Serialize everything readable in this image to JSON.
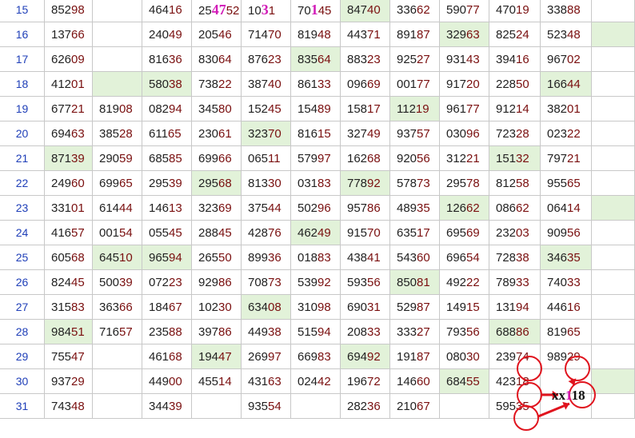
{
  "table": {
    "rows": [
      {
        "day": "15",
        "highlight": [
          7
        ],
        "cells": [
          [
            "852",
            "98"
          ],
          [
            "",
            ""
          ],
          [
            "464",
            "16"
          ],
          [
            "25",
            "52",
            "47"
          ],
          [
            "10",
            "1",
            "3"
          ],
          [
            "70",
            "45",
            "1"
          ],
          [
            "847",
            "40"
          ],
          [
            "336",
            "62"
          ],
          [
            "590",
            "77"
          ],
          [
            "470",
            "19"
          ],
          [
            "338",
            "88"
          ],
          [
            "",
            ""
          ]
        ]
      },
      {
        "day": "16",
        "highlight": [
          9,
          12
        ],
        "cells": [
          [
            "137",
            "66"
          ],
          [
            "",
            ""
          ],
          [
            "240",
            "49"
          ],
          [
            "205",
            "46"
          ],
          [
            "714",
            "70"
          ],
          [
            "819",
            "48"
          ],
          [
            "443",
            "71"
          ],
          [
            "891",
            "87"
          ],
          [
            "329",
            "63"
          ],
          [
            "825",
            "24"
          ],
          [
            "523",
            "48"
          ],
          [
            "",
            ""
          ]
        ]
      },
      {
        "day": "17",
        "highlight": [
          6
        ],
        "cells": [
          [
            "626",
            "09"
          ],
          [
            "",
            ""
          ],
          [
            "816",
            "36"
          ],
          [
            "830",
            "64"
          ],
          [
            "876",
            "23"
          ],
          [
            "835",
            "64"
          ],
          [
            "883",
            "23"
          ],
          [
            "925",
            "27"
          ],
          [
            "931",
            "43"
          ],
          [
            "394",
            "16"
          ],
          [
            "967",
            "02"
          ],
          [
            "",
            ""
          ]
        ]
      },
      {
        "day": "18",
        "highlight": [
          2,
          3,
          11
        ],
        "cells": [
          [
            "412",
            "01"
          ],
          [
            "",
            ""
          ],
          [
            "580",
            "38"
          ],
          [
            "738",
            "22"
          ],
          [
            "387",
            "40"
          ],
          [
            "861",
            "33"
          ],
          [
            "096",
            "69"
          ],
          [
            "001",
            "77"
          ],
          [
            "917",
            "20"
          ],
          [
            "228",
            "50"
          ],
          [
            "166",
            "44"
          ],
          [
            "",
            ""
          ]
        ]
      },
      {
        "day": "19",
        "highlight": [
          8
        ],
        "cells": [
          [
            "677",
            "21"
          ],
          [
            "819",
            "08"
          ],
          [
            "082",
            "94"
          ],
          [
            "345",
            "80"
          ],
          [
            "152",
            "45"
          ],
          [
            "154",
            "89"
          ],
          [
            "158",
            "17"
          ],
          [
            "112",
            "19"
          ],
          [
            "961",
            "77"
          ],
          [
            "912",
            "14"
          ],
          [
            "382",
            "01"
          ],
          [
            "",
            ""
          ]
        ]
      },
      {
        "day": "20",
        "highlight": [
          5
        ],
        "cells": [
          [
            "694",
            "63"
          ],
          [
            "385",
            "28"
          ],
          [
            "611",
            "65"
          ],
          [
            "230",
            "61"
          ],
          [
            "323",
            "70"
          ],
          [
            "816",
            "15"
          ],
          [
            "327",
            "49"
          ],
          [
            "937",
            "57"
          ],
          [
            "030",
            "96"
          ],
          [
            "723",
            "28"
          ],
          [
            "023",
            "22"
          ],
          [
            "",
            ""
          ]
        ]
      },
      {
        "day": "21",
        "highlight": [
          1,
          10
        ],
        "cells": [
          [
            "871",
            "39"
          ],
          [
            "290",
            "59"
          ],
          [
            "685",
            "85"
          ],
          [
            "699",
            "66"
          ],
          [
            "065",
            "11"
          ],
          [
            "579",
            "97"
          ],
          [
            "162",
            "68"
          ],
          [
            "920",
            "56"
          ],
          [
            "312",
            "21"
          ],
          [
            "151",
            "32"
          ],
          [
            "797",
            "21"
          ],
          [
            "",
            ""
          ]
        ]
      },
      {
        "day": "22",
        "highlight": [
          4,
          7
        ],
        "cells": [
          [
            "249",
            "60"
          ],
          [
            "699",
            "65"
          ],
          [
            "295",
            "39"
          ],
          [
            "295",
            "68"
          ],
          [
            "813",
            "30"
          ],
          [
            "031",
            "83"
          ],
          [
            "778",
            "92"
          ],
          [
            "578",
            "73"
          ],
          [
            "295",
            "78"
          ],
          [
            "812",
            "58"
          ],
          [
            "955",
            "65"
          ],
          [
            "",
            ""
          ]
        ]
      },
      {
        "day": "23",
        "highlight": [
          9,
          12
        ],
        "cells": [
          [
            "331",
            "01"
          ],
          [
            "614",
            "44"
          ],
          [
            "146",
            "13"
          ],
          [
            "323",
            "69"
          ],
          [
            "375",
            "44"
          ],
          [
            "502",
            "96"
          ],
          [
            "957",
            "86"
          ],
          [
            "489",
            "35"
          ],
          [
            "126",
            "62"
          ],
          [
            "086",
            "62"
          ],
          [
            "064",
            "14"
          ],
          [
            "",
            ""
          ]
        ]
      },
      {
        "day": "24",
        "highlight": [
          6
        ],
        "cells": [
          [
            "416",
            "57"
          ],
          [
            "001",
            "54"
          ],
          [
            "055",
            "45"
          ],
          [
            "288",
            "45"
          ],
          [
            "428",
            "76"
          ],
          [
            "462",
            "49"
          ],
          [
            "915",
            "70"
          ],
          [
            "635",
            "17"
          ],
          [
            "695",
            "69"
          ],
          [
            "232",
            "03"
          ],
          [
            "909",
            "56"
          ],
          [
            "",
            ""
          ]
        ]
      },
      {
        "day": "25",
        "highlight": [
          2,
          3,
          11
        ],
        "cells": [
          [
            "605",
            "68"
          ],
          [
            "645",
            "10"
          ],
          [
            "965",
            "94"
          ],
          [
            "265",
            "50"
          ],
          [
            "899",
            "36"
          ],
          [
            "018",
            "83"
          ],
          [
            "438",
            "41"
          ],
          [
            "543",
            "60"
          ],
          [
            "696",
            "54"
          ],
          [
            "728",
            "38"
          ],
          [
            "346",
            "35"
          ],
          [
            "",
            ""
          ]
        ]
      },
      {
        "day": "26",
        "highlight": [
          8
        ],
        "cells": [
          [
            "824",
            "45"
          ],
          [
            "500",
            "39"
          ],
          [
            "072",
            "23"
          ],
          [
            "929",
            "86"
          ],
          [
            "708",
            "73"
          ],
          [
            "539",
            "92"
          ],
          [
            "593",
            "56"
          ],
          [
            "850",
            "81"
          ],
          [
            "492",
            "22"
          ],
          [
            "789",
            "33"
          ],
          [
            "740",
            "33"
          ],
          [
            "",
            ""
          ]
        ]
      },
      {
        "day": "27",
        "highlight": [
          5
        ],
        "cells": [
          [
            "315",
            "83"
          ],
          [
            "363",
            "66"
          ],
          [
            "184",
            "67"
          ],
          [
            "102",
            "30"
          ],
          [
            "634",
            "08"
          ],
          [
            "310",
            "98"
          ],
          [
            "690",
            "31"
          ],
          [
            "529",
            "87"
          ],
          [
            "149",
            "15"
          ],
          [
            "131",
            "94"
          ],
          [
            "446",
            "16"
          ],
          [
            "",
            ""
          ]
        ]
      },
      {
        "day": "28",
        "highlight": [
          1,
          10
        ],
        "cells": [
          [
            "984",
            "51"
          ],
          [
            "716",
            "57"
          ],
          [
            "235",
            "88"
          ],
          [
            "397",
            "86"
          ],
          [
            "449",
            "38"
          ],
          [
            "515",
            "94"
          ],
          [
            "208",
            "33"
          ],
          [
            "333",
            "27"
          ],
          [
            "793",
            "56"
          ],
          [
            "688",
            "86"
          ],
          [
            "819",
            "65"
          ],
          [
            "",
            ""
          ]
        ]
      },
      {
        "day": "29",
        "highlight": [
          4,
          7
        ],
        "cells": [
          [
            "755",
            "47"
          ],
          [
            "",
            ""
          ],
          [
            "461",
            "68"
          ],
          [
            "194",
            "47"
          ],
          [
            "269",
            "97"
          ],
          [
            "669",
            "83"
          ],
          [
            "694",
            "92"
          ],
          [
            "191",
            "87"
          ],
          [
            "080",
            "30"
          ],
          [
            "239",
            "74"
          ],
          [
            "989",
            "29"
          ],
          [
            "",
            ""
          ]
        ]
      },
      {
        "day": "30",
        "highlight": [
          9,
          12
        ],
        "cells": [
          [
            "937",
            "29"
          ],
          [
            "",
            ""
          ],
          [
            "449",
            "00"
          ],
          [
            "455",
            "14"
          ],
          [
            "431",
            "63"
          ],
          [
            "024",
            "42"
          ],
          [
            "196",
            "72"
          ],
          [
            "146",
            "60"
          ],
          [
            "684",
            "55"
          ],
          [
            "423",
            "18"
          ],
          [
            "",
            ""
          ],
          [
            "",
            ""
          ]
        ]
      },
      {
        "day": "31",
        "highlight": [],
        "cells": [
          [
            "743",
            "48"
          ],
          [
            "",
            ""
          ],
          [
            "344",
            "39"
          ],
          [
            "",
            ""
          ],
          [
            "935",
            "54"
          ],
          [
            "",
            ""
          ],
          [
            "282",
            "36"
          ],
          [
            "210",
            "67"
          ],
          [
            "",
            ""
          ],
          [
            "595",
            "35"
          ],
          [
            "",
            ""
          ],
          [
            "",
            ""
          ]
        ]
      }
    ]
  },
  "annotation": {
    "label_prefix": "xx",
    "label_mid": "1",
    "label_suffix": "18",
    "circle_color": "#e0141e",
    "circled_values": [
      "74",
      "29",
      "18",
      "35"
    ]
  },
  "colors": {
    "highlight": "#e2f2d9",
    "day_number": "#1f3fb8",
    "digit_dark": "#222222",
    "digit_red": "#7a0f0f",
    "magenta": "#d21bb8"
  }
}
